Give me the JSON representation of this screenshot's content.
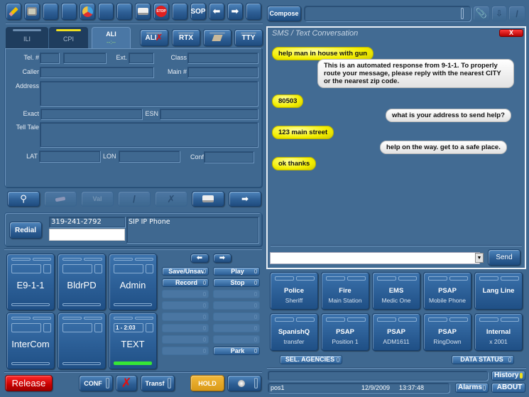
{
  "toolbar": {
    "buttons": [
      {
        "icon": "pencil-eraser-icon",
        "label": ""
      },
      {
        "icon": "film-camera-icon",
        "label": ""
      },
      {
        "icon": "",
        "label": ""
      },
      {
        "icon": "",
        "label": ""
      },
      {
        "icon": "agencies-badge-icon",
        "label": ""
      },
      {
        "icon": "",
        "label": ""
      },
      {
        "icon": "",
        "label": ""
      },
      {
        "icon": "printer-icon",
        "label": ""
      },
      {
        "icon": "stop-sign-icon",
        "label": "STOP"
      },
      {
        "icon": "",
        "label": ""
      },
      {
        "icon": "sop-icon",
        "label": "SOP"
      },
      {
        "icon": "arrow-left-icon",
        "label": ""
      },
      {
        "icon": "arrow-right-icon",
        "label": ""
      },
      {
        "icon": "",
        "label": ""
      }
    ]
  },
  "tabs": {
    "ili": "ILI",
    "cpi": "CPI",
    "ali": "ALI",
    "ali_status": "--:--"
  },
  "toggles": {
    "alix": "ALI",
    "rtx": "RTX",
    "tty": "TTY"
  },
  "ali_form": {
    "tel_label": "Tel. #",
    "tel_area": "",
    "tel_number": "",
    "ext_label": "Ext.",
    "ext_value": "",
    "class_label": "Class",
    "class_value": "",
    "caller_label": "Caller",
    "caller_value": "",
    "main_label": "Main #",
    "main_value": "",
    "address_label": "Address",
    "address_value": "",
    "exact_label": "Exact",
    "exact_value": "",
    "esn_label": "ESN",
    "esn_value": "",
    "telltale_label": "Tell Tale",
    "telltale_value": "",
    "lat_label": "LAT",
    "lat_value": "",
    "lon_label": "LON",
    "lon_value": "",
    "conf_label": "Conf",
    "conf_value": ""
  },
  "ali_actions": {
    "val_label": "Val"
  },
  "call": {
    "redial_label": "Redial",
    "number": "319-241-2792",
    "dial_input": "",
    "device": "SIP IP Phone"
  },
  "lines": [
    {
      "name": "E9-1-1",
      "display": "",
      "active": false
    },
    {
      "name": "BldrPD",
      "display": "",
      "active": false
    },
    {
      "name": "Admin",
      "display": "",
      "active": false
    },
    {
      "name": "InterCom",
      "display": "",
      "active": false
    },
    {
      "name": "",
      "display": "",
      "active": false
    },
    {
      "name": "TEXT",
      "display": "1 - 2:03",
      "active": true
    }
  ],
  "recorder": {
    "save": "Save/Unsav",
    "play": "Play",
    "record": "Record",
    "stop": "Stop",
    "park": "Park"
  },
  "bottom_bar": {
    "release": "Release",
    "conf": "CONF",
    "transf": "Transf",
    "hold": "HOLD"
  },
  "compose": {
    "label": "Compose",
    "value": ""
  },
  "sms": {
    "title": "SMS / Text Conversation",
    "close": "X",
    "messages": [
      {
        "dir": "in",
        "text": "help man in house with gun"
      },
      {
        "dir": "out",
        "text": "This is an automated response from 9-1-1. To properly route your message, please reply with the nearest CITY or the nearest zip code."
      },
      {
        "dir": "in",
        "text": "80503"
      },
      {
        "dir": "out",
        "text": "what is your address to send help?"
      },
      {
        "dir": "in",
        "text": "123 main street"
      },
      {
        "dir": "out",
        "text": "help on the way. get to a safe place."
      },
      {
        "dir": "in",
        "text": "ok thanks"
      }
    ],
    "input_value": "",
    "send": "Send"
  },
  "agencies": [
    {
      "name": "Police",
      "sub": "Sheriff"
    },
    {
      "name": "Fire",
      "sub": "Main Station"
    },
    {
      "name": "EMS",
      "sub": "Medic One"
    },
    {
      "name": "PSAP",
      "sub": "Mobile Phone"
    },
    {
      "name": "Lang Line",
      "sub": ""
    },
    {
      "name": "SpanishQ",
      "sub": "transfer"
    },
    {
      "name": "PSAP",
      "sub": "Position 1"
    },
    {
      "name": "PSAP",
      "sub": "ADM1611"
    },
    {
      "name": "PSAP",
      "sub": "RingDown"
    },
    {
      "name": "Internal",
      "sub": "x 2001"
    }
  ],
  "agency_controls": {
    "select": "SEL. AGENCIES",
    "data_status": "DATA STATUS"
  },
  "status": {
    "message": "",
    "position": "pos1",
    "date": "12/9/2009",
    "time": "13:37:48",
    "history": "History",
    "alarms": "Alarms",
    "about": "ABOUT"
  },
  "colors": {
    "background": "#3f6890",
    "release": "#d40000",
    "hold": "#e0a020",
    "incoming_bubble": "#f3ee00",
    "active_line": "#36e636"
  }
}
